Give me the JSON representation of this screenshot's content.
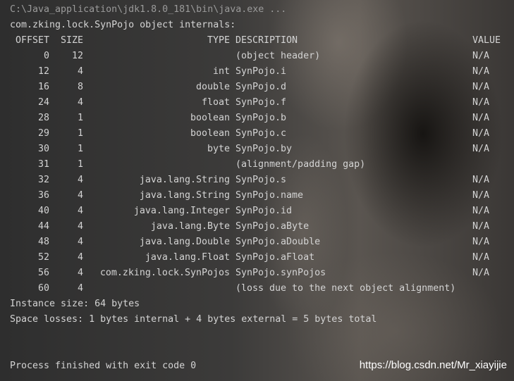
{
  "command_line": "C:\\Java_application\\jdk1.8.0_181\\bin\\java.exe ...",
  "title_line": "com.zking.lock.SynPojo object internals:",
  "headers": {
    "offset": "OFFSET",
    "size": "SIZE",
    "type": "TYPE",
    "description": "DESCRIPTION",
    "value": "VALUE"
  },
  "rows": [
    {
      "offset": "0",
      "size": "12",
      "type": "",
      "description": "(object header)",
      "value": "N/A"
    },
    {
      "offset": "12",
      "size": "4",
      "type": "int",
      "description": "SynPojo.i",
      "value": "N/A"
    },
    {
      "offset": "16",
      "size": "8",
      "type": "double",
      "description": "SynPojo.d",
      "value": "N/A"
    },
    {
      "offset": "24",
      "size": "4",
      "type": "float",
      "description": "SynPojo.f",
      "value": "N/A"
    },
    {
      "offset": "28",
      "size": "1",
      "type": "boolean",
      "description": "SynPojo.b",
      "value": "N/A"
    },
    {
      "offset": "29",
      "size": "1",
      "type": "boolean",
      "description": "SynPojo.c",
      "value": "N/A"
    },
    {
      "offset": "30",
      "size": "1",
      "type": "byte",
      "description": "SynPojo.by",
      "value": "N/A"
    },
    {
      "offset": "31",
      "size": "1",
      "type": "",
      "description": "(alignment/padding gap)",
      "value": ""
    },
    {
      "offset": "32",
      "size": "4",
      "type": "java.lang.String",
      "description": "SynPojo.s",
      "value": "N/A"
    },
    {
      "offset": "36",
      "size": "4",
      "type": "java.lang.String",
      "description": "SynPojo.name",
      "value": "N/A"
    },
    {
      "offset": "40",
      "size": "4",
      "type": "java.lang.Integer",
      "description": "SynPojo.id",
      "value": "N/A"
    },
    {
      "offset": "44",
      "size": "4",
      "type": "java.lang.Byte",
      "description": "SynPojo.aByte",
      "value": "N/A"
    },
    {
      "offset": "48",
      "size": "4",
      "type": "java.lang.Double",
      "description": "SynPojo.aDouble",
      "value": "N/A"
    },
    {
      "offset": "52",
      "size": "4",
      "type": "java.lang.Float",
      "description": "SynPojo.aFloat",
      "value": "N/A"
    },
    {
      "offset": "56",
      "size": "4",
      "type": "com.zking.lock.SynPojos",
      "description": "SynPojo.synPojos",
      "value": "N/A"
    },
    {
      "offset": "60",
      "size": "4",
      "type": "",
      "description": "(loss due to the next object alignment)",
      "value": ""
    }
  ],
  "instance_size": "Instance size: 64 bytes",
  "space_losses": "Space losses: 1 bytes internal + 4 bytes external = 5 bytes total",
  "exit_message": "Process finished with exit code 0",
  "watermark": "https://blog.csdn.net/Mr_xiayijie"
}
